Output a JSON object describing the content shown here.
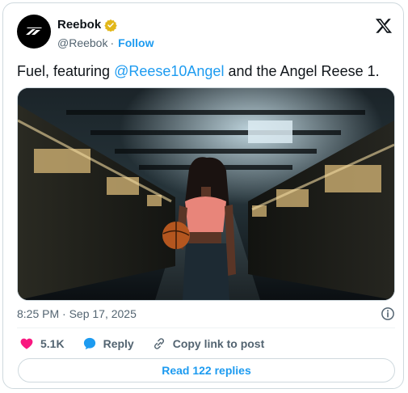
{
  "tweet": {
    "author_name": "Reebok",
    "handle": "@Reebok",
    "separator": "·",
    "follow_label": "Follow",
    "text_before": "Fuel, featuring ",
    "mention": "@Reese10Angel",
    "text_after": " and the Angel Reese 1.",
    "timestamp": "8:25 PM · Sep 17, 2025"
  },
  "actions": {
    "likes": "5.1K",
    "reply_label": "Reply",
    "copy_link_label": "Copy link to post"
  },
  "read_replies_label": "Read 122 replies",
  "colors": {
    "accent": "#1d9bf0",
    "like": "#f91880",
    "verified_badge": "#e2b719",
    "muted_text": "#536471"
  },
  "icons": [
    "reebok-logo-icon",
    "verified-badge-icon",
    "x-logo-icon",
    "info-icon",
    "heart-icon",
    "reply-icon",
    "link-icon"
  ]
}
